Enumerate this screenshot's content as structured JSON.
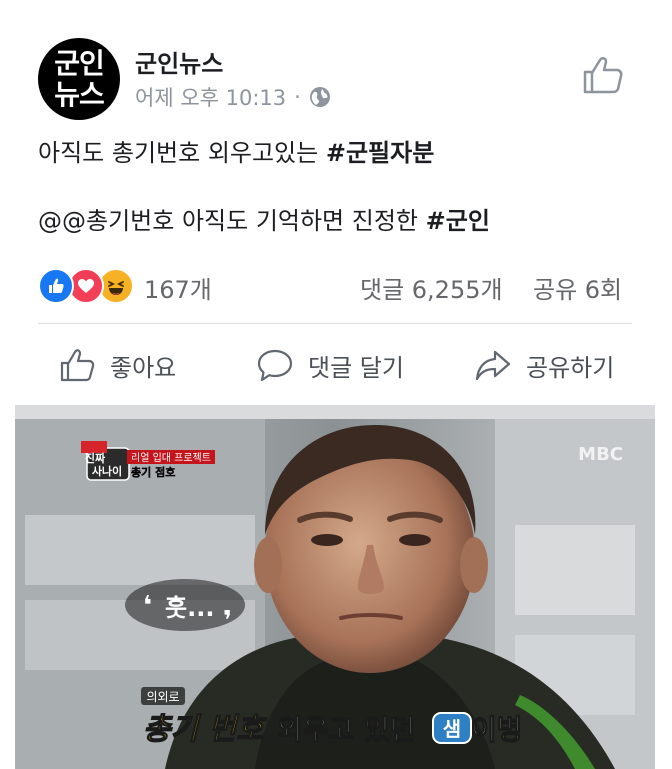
{
  "page": {
    "name": "군인뉴스",
    "avatar_line1": "군인",
    "avatar_line2": "뉴스"
  },
  "meta": {
    "time": "어제 오후 10:13",
    "separator": "·",
    "privacy_icon": "globe-icon"
  },
  "post": {
    "line1_text": "아직도 총기번호 외우고있는 ",
    "line1_hashtag": "#군필자분",
    "line2_text": "@@총기번호 아직도 기억하면 진정한 ",
    "line2_hashtag": "#군인"
  },
  "stats": {
    "reactions": "167개",
    "comments": "댓글 6,255개",
    "shares": "공유 6회"
  },
  "actions": {
    "like": "좋아요",
    "comment": "댓글 달기",
    "share": "공유하기"
  },
  "photo": {
    "broadcaster": "MBC",
    "show_title_top": "진짜",
    "show_title_bottom": "사나이",
    "program_line1": "리얼 입대 프로젝트",
    "program_line2": "총기 점호",
    "speech": "훗...",
    "subtitle_label": "의외로",
    "subtitle_before": "총기 번호",
    "subtitle_middle": " 외우고 있던 ",
    "subtitle_badge": "샘",
    "subtitle_after": " 이병"
  },
  "colors": {
    "accent": "#1877f2",
    "love": "#f33e58",
    "haha": "#f7b125",
    "subtitle_yellow": "#ffd800"
  }
}
